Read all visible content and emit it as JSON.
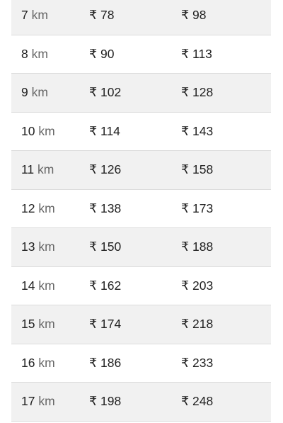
{
  "fare_table": {
    "unit": "km",
    "currency": "₹",
    "rows": [
      {
        "distance": "7",
        "fare_a": "78",
        "fare_b": "98"
      },
      {
        "distance": "8",
        "fare_a": "90",
        "fare_b": "113"
      },
      {
        "distance": "9",
        "fare_a": "102",
        "fare_b": "128"
      },
      {
        "distance": "10",
        "fare_a": "114",
        "fare_b": "143"
      },
      {
        "distance": "11",
        "fare_a": "126",
        "fare_b": "158"
      },
      {
        "distance": "12",
        "fare_a": "138",
        "fare_b": "173"
      },
      {
        "distance": "13",
        "fare_a": "150",
        "fare_b": "188"
      },
      {
        "distance": "14",
        "fare_a": "162",
        "fare_b": "203"
      },
      {
        "distance": "15",
        "fare_a": "174",
        "fare_b": "218"
      },
      {
        "distance": "16",
        "fare_a": "186",
        "fare_b": "233"
      },
      {
        "distance": "17",
        "fare_a": "198",
        "fare_b": "248"
      }
    ]
  }
}
